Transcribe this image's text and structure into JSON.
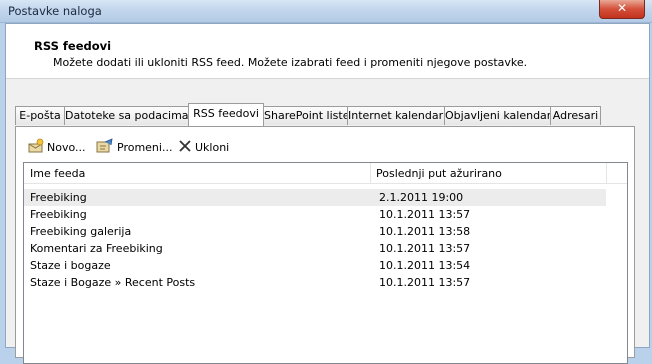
{
  "window": {
    "title": "Postavke naloga",
    "close_label": "✕"
  },
  "header": {
    "title": "RSS feedovi",
    "description": "Možete dodati ili ukloniti RSS feed. Možete izabrati feed i promeniti njegove postavke."
  },
  "tabs": [
    {
      "label": "E-pošta"
    },
    {
      "label": "Datoteke sa podacima"
    },
    {
      "label": "RSS feedovi",
      "active": true
    },
    {
      "label": "SharePoint liste"
    },
    {
      "label": "Internet kalendari"
    },
    {
      "label": "Objavljeni kalendari"
    },
    {
      "label": "Adresari"
    }
  ],
  "toolbar": {
    "new_label": "Novo...",
    "change_label": "Promeni...",
    "remove_label": "Ukloni"
  },
  "table": {
    "columns": [
      "Ime feeda",
      "Poslednji put ažurirano"
    ],
    "rows": [
      {
        "name": "Freebiking",
        "updated": "2.1.2011 19:00",
        "selected": true
      },
      {
        "name": "Freebiking",
        "updated": "10.1.2011 13:57"
      },
      {
        "name": "Freebiking galerija",
        "updated": "10.1.2011 13:58"
      },
      {
        "name": "Komentari za Freebiking",
        "updated": "10.1.2011 13:57"
      },
      {
        "name": "Staze i bogaze",
        "updated": "10.1.2011 13:54"
      },
      {
        "name": "Staze i Bogaze » Recent Posts",
        "updated": "10.1.2011 13:57"
      }
    ]
  },
  "colors": {
    "title_bar": "#c2d6ec",
    "close_button": "#d4503a",
    "selection": "#ececec"
  }
}
